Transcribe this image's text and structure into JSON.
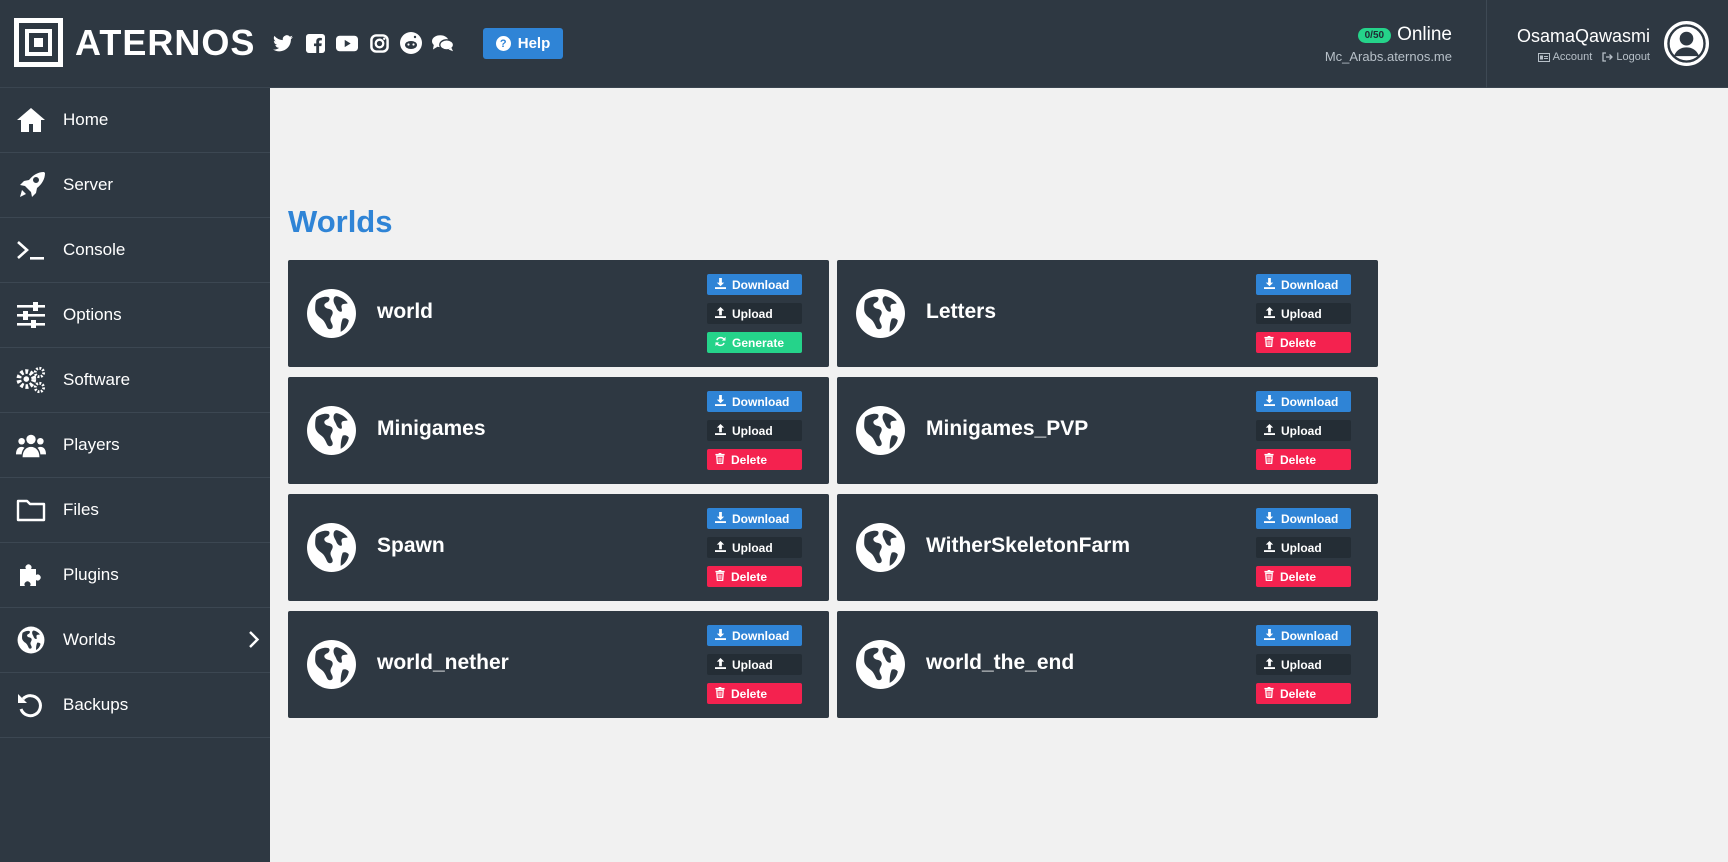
{
  "header": {
    "logo_text": "ATERNOS",
    "socials": [
      {
        "icon": "twitter-icon"
      },
      {
        "icon": "facebook-icon"
      },
      {
        "icon": "youtube-icon"
      },
      {
        "icon": "instagram-icon"
      },
      {
        "icon": "reddit-icon"
      },
      {
        "icon": "chat-icon"
      }
    ],
    "help_label": "Help",
    "players_badge": "0/50",
    "status": "Online",
    "address": "Mc_Arabs.aternos.me",
    "username": "OsamaQawasmi",
    "account_label": "Account",
    "logout_label": "Logout"
  },
  "sidebar": {
    "items": [
      {
        "label": "Home",
        "icon": "home-icon"
      },
      {
        "label": "Server",
        "icon": "rocket-icon"
      },
      {
        "label": "Console",
        "icon": "terminal-icon"
      },
      {
        "label": "Options",
        "icon": "sliders-icon"
      },
      {
        "label": "Software",
        "icon": "gears-icon"
      },
      {
        "label": "Players",
        "icon": "users-icon"
      },
      {
        "label": "Files",
        "icon": "folder-icon"
      },
      {
        "label": "Plugins",
        "icon": "puzzle-icon"
      },
      {
        "label": "Worlds",
        "icon": "globe-icon",
        "active": true
      },
      {
        "label": "Backups",
        "icon": "undo-icon"
      }
    ]
  },
  "main": {
    "title": "Worlds",
    "buttons": {
      "download": "Download",
      "upload": "Upload",
      "delete": "Delete",
      "generate": "Generate"
    },
    "worlds": [
      {
        "name": "world",
        "third_action": "generate"
      },
      {
        "name": "Letters",
        "third_action": "delete"
      },
      {
        "name": "Minigames",
        "third_action": "delete"
      },
      {
        "name": "Minigames_PVP",
        "third_action": "delete"
      },
      {
        "name": "Spawn",
        "third_action": "delete"
      },
      {
        "name": "WitherSkeletonFarm",
        "third_action": "delete"
      },
      {
        "name": "world_nether",
        "third_action": "delete"
      },
      {
        "name": "world_the_end",
        "third_action": "delete"
      }
    ]
  },
  "colors": {
    "dark": "#2e3842",
    "blue": "#2f84d6",
    "red": "#f4224f",
    "green": "#25d38a",
    "content_bg": "#f1f1f1"
  }
}
